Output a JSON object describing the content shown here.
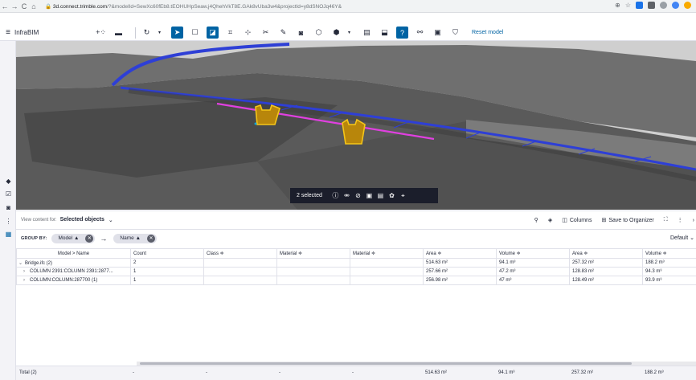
{
  "browser": {
    "url_host": "3d.connect.trimble.com",
    "url_path": "/?&modelId=SewXc60fEb8.tEOHUHpSeaw,j4QhehVkT8E.GAk8vUba3w4&projectId=y8dSNOJq46Y&"
  },
  "app": {
    "title": "InfraBIM",
    "reset_label": "Reset model"
  },
  "selection": {
    "text": "2 selected"
  },
  "content": {
    "view_label": "View content for:",
    "view_value": "Selected objects",
    "columns_label": "Columns",
    "save_label": "Save to Organizer",
    "group_by_label": "GROUP BY:",
    "groups": [
      "Model ▲",
      "Name ▲"
    ],
    "default_label": "Default"
  },
  "table": {
    "headers": [
      "Model > Name",
      "Count",
      "Class ≑",
      "Material ≑",
      "Material ≑",
      "Area ≑",
      "Volume ≑",
      "Area ≑",
      "Volume ≑"
    ],
    "rows": [
      {
        "name": "Bridge.ifc (2)",
        "count": "2",
        "area1": "514.63 m²",
        "volume1": "94.1 m³",
        "area2": "257.32 m²",
        "volume2": "188.2 m³"
      },
      {
        "name": "COLUMN 2391:COLUMN 2391:2877...",
        "count": "1",
        "area1": "257.66 m²",
        "volume1": "47.2 m³",
        "area2": "128.83 m²",
        "volume2": "94.3 m³"
      },
      {
        "name": "COLUMN:COLUMN:287700 (1)",
        "count": "1",
        "area1": "256.98 m²",
        "volume1": "47 m³",
        "area2": "128.49 m²",
        "volume2": "93.9 m³"
      }
    ],
    "footer": {
      "label": "Total (2)",
      "count": "-",
      "class": "-",
      "material1": "-",
      "material2": "-",
      "area1": "514.63 m²",
      "volume1": "94.1 m³",
      "area2": "257.32 m²",
      "volume2": "188.2 m³"
    }
  },
  "colors": {
    "accent": "#0063a3",
    "selection_bar": "#1b1e2b",
    "highlight": "#f5c518",
    "road": "#2e3fd6",
    "magenta": "#e040e0"
  }
}
